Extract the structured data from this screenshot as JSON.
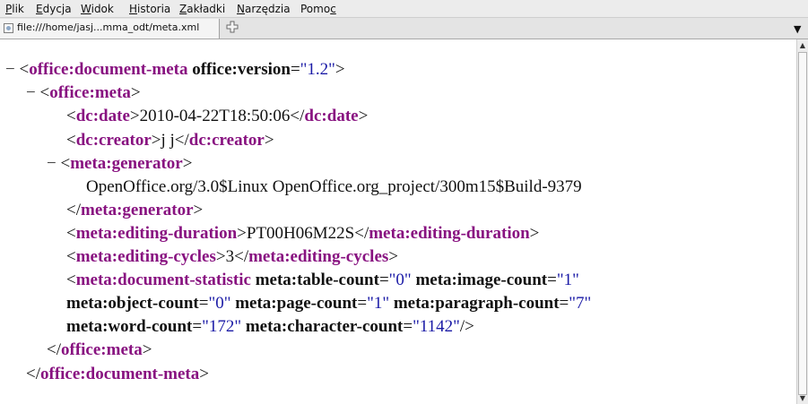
{
  "menu": [
    {
      "u": "P",
      "rest": "lik"
    },
    {
      "u": "E",
      "rest": "dycja"
    },
    {
      "u": "W",
      "rest": "idok"
    },
    {
      "u": "H",
      "rest": "istoria"
    },
    {
      "u": "Z",
      "rest": "akładki"
    },
    {
      "u": "N",
      "rest": "arzędzia"
    },
    {
      "pre": "Pomo",
      "u": "c"
    }
  ],
  "tab": {
    "title": "file:///home/jasj...mma_odt/meta.xml",
    "new_tab_icon": "plus-icon",
    "list_icon": "chevron-down-icon"
  },
  "scrollbar": {
    "up_icon": "arrow-up-icon",
    "down_icon": "arrow-down-icon"
  },
  "xml": {
    "l1": {
      "minus": "−",
      "lt": "<",
      "tag": "office:document-meta",
      "attr": "office:version",
      "eq": "=",
      "val": "\"1.2\"",
      "gt": ">"
    },
    "l2": {
      "minus": "−",
      "lt": "<",
      "tag": "office:meta",
      "gt": ">"
    },
    "l3": {
      "lt": "<",
      "tag": "dc:date",
      "gt": ">",
      "text": "2010-04-22T18:50:06",
      "lt2": "</",
      "tag2": "dc:date",
      "gt2": ">"
    },
    "l4": {
      "lt": "<",
      "tag": "dc:creator",
      "gt": ">",
      "text": "j j",
      "lt2": "</",
      "tag2": "dc:creator",
      "gt2": ">"
    },
    "l5": {
      "minus": "−",
      "lt": "<",
      "tag": "meta:generator",
      "gt": ">"
    },
    "l6": {
      "text": "OpenOffice.org/3.0$Linux OpenOffice.org_project/300m15$Build-9379"
    },
    "l7": {
      "lt": "</",
      "tag": "meta:generator",
      "gt": ">"
    },
    "l8": {
      "lt": "<",
      "tag": "meta:editing-duration",
      "gt": ">",
      "text": "PT00H06M22S",
      "lt2": "</",
      "tag2": "meta:editing-duration",
      "gt2": ">"
    },
    "l9": {
      "lt": "<",
      "tag": "meta:editing-cycles",
      "gt": ">",
      "text": "3",
      "lt2": "</",
      "tag2": "meta:editing-cycles",
      "gt2": ">"
    },
    "l10": {
      "lt": "<",
      "tag": "meta:document-statistic",
      "a1": "meta:table-count",
      "v1": "\"0\"",
      "a2": "meta:image-count",
      "v2": "\"1\"",
      "eq": "="
    },
    "l11": {
      "a1": "meta:object-count",
      "v1": "\"0\"",
      "a2": "meta:page-count",
      "v2": "\"1\"",
      "a3": "meta:paragraph-count",
      "v3": "\"7\"",
      "eq": "="
    },
    "l12": {
      "a1": "meta:word-count",
      "v1": "\"172\"",
      "a2": "meta:character-count",
      "v2": "\"1142\"",
      "eq": "=",
      "end": "/>"
    },
    "l13": {
      "lt": "</",
      "tag": "office:meta",
      "gt": ">"
    },
    "l14": {
      "lt": "</",
      "tag": "office:document-meta",
      "gt": ">"
    }
  }
}
